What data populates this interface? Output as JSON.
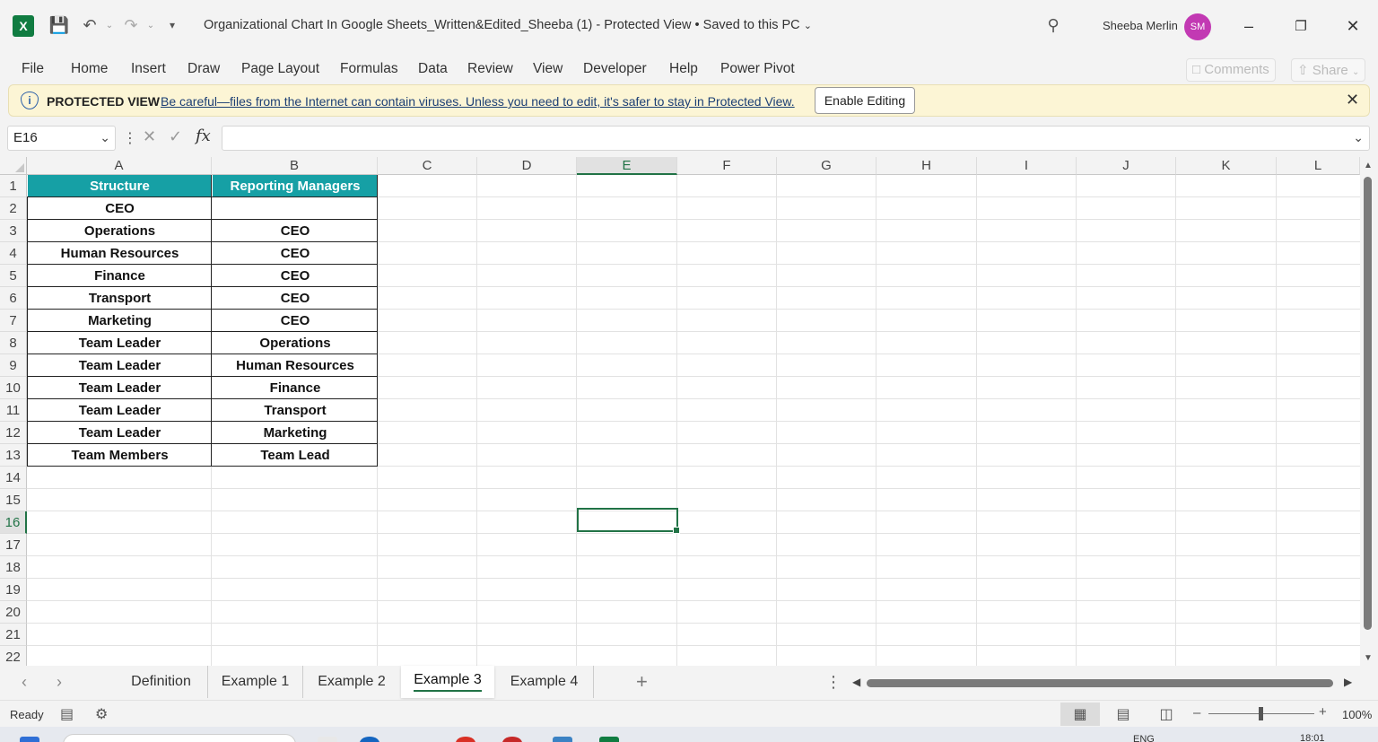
{
  "app": {
    "title": "Organizational Chart In Google Sheets_Written&Edited_Sheeba (1)  -  Protected View • Saved to this PC",
    "user_name": "Sheeba Merlin",
    "user_initials": "SM",
    "accent_color": "#217346",
    "avatar_color": "#c239b3"
  },
  "ribbon": {
    "tabs": [
      "File",
      "Home",
      "Insert",
      "Draw",
      "Page Layout",
      "Formulas",
      "Data",
      "Review",
      "View",
      "Developer",
      "Help",
      "Power Pivot"
    ],
    "comments_label": "Comments",
    "share_label": "Share"
  },
  "protected_view": {
    "label": "PROTECTED VIEW",
    "message": "Be careful—files from the Internet can contain viruses. Unless you need to edit, it's safer to stay in Protected View.",
    "button_label": "Enable Editing",
    "bar_color": "#fcf5d5"
  },
  "formula_bar": {
    "name_box": "E16",
    "fx_label": "fx",
    "formula": ""
  },
  "grid": {
    "columns": [
      "A",
      "B",
      "C",
      "D",
      "E",
      "F",
      "G",
      "H",
      "I",
      "J",
      "K",
      "L"
    ],
    "rows": [
      "1",
      "2",
      "3",
      "4",
      "5",
      "6",
      "7",
      "8",
      "9",
      "10",
      "11",
      "12",
      "13",
      "14",
      "15",
      "16",
      "17",
      "18",
      "19",
      "20",
      "21",
      "22"
    ],
    "active_column": "E",
    "active_row": "16",
    "header_fill": "#16a0a5",
    "table": {
      "headers": [
        "Structure",
        "Reporting Managers"
      ],
      "rows": [
        [
          "CEO",
          ""
        ],
        [
          "Operations",
          "CEO"
        ],
        [
          "Human Resources",
          "CEO"
        ],
        [
          "Finance",
          "CEO"
        ],
        [
          "Transport",
          "CEO"
        ],
        [
          "Marketing",
          "CEO"
        ],
        [
          "Team Leader",
          "Operations"
        ],
        [
          "Team Leader",
          "Human Resources"
        ],
        [
          "Team Leader",
          "Finance"
        ],
        [
          "Team Leader",
          "Transport"
        ],
        [
          "Team Leader",
          "Marketing"
        ],
        [
          "Team Members",
          "Team Lead"
        ]
      ]
    }
  },
  "sheets": {
    "tabs": [
      "Definition",
      "Example 1",
      "Example 2",
      "Example 3",
      "Example 4"
    ],
    "active": "Example 3"
  },
  "status": {
    "text": "Ready",
    "zoom": "100%"
  },
  "taskbar": {
    "language": "ENG",
    "time": "18:01"
  }
}
